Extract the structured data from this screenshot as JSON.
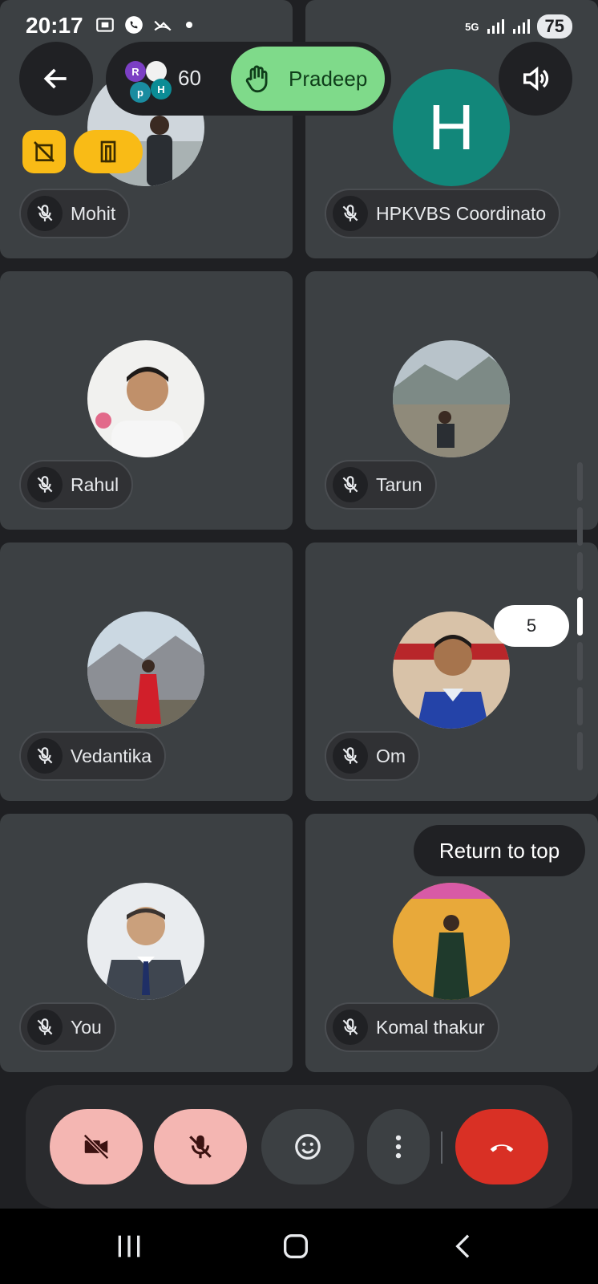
{
  "status_bar": {
    "time": "20:17",
    "network": "5G",
    "battery": "75"
  },
  "top_controls": {
    "participant_count": "60",
    "mini_avatars": [
      "R",
      "p",
      "H"
    ],
    "raised_hand_name": "Pradeep"
  },
  "tiles": [
    {
      "name": "Mohit"
    },
    {
      "name": "HPKVBS Coordinato",
      "initial": "H"
    },
    {
      "name": "Rahul"
    },
    {
      "name": "Tarun"
    },
    {
      "name": "Vedantika"
    },
    {
      "name": "Om"
    },
    {
      "name": "You"
    },
    {
      "name": "Komal thakur"
    }
  ],
  "scroll": {
    "page_indicator": "5",
    "return_to_top": "Return to top"
  },
  "colors": {
    "background": "#1f2023",
    "tile": "#3c4043",
    "raised_hand_green": "#7fda8a",
    "end_call_red": "#d93025",
    "muted_pink": "#f4b6b2",
    "letter_avatar": "#12877a",
    "yellow_chip": "#f9bb16"
  },
  "icons": {
    "back": "arrow-left-icon",
    "speaker": "speaker-icon",
    "hand": "raised-hand-icon",
    "camera_off": "camera-off-icon",
    "mic_off": "mic-off-icon",
    "emoji": "emoji-icon",
    "more": "more-vert-icon",
    "end_call": "end-call-icon"
  }
}
